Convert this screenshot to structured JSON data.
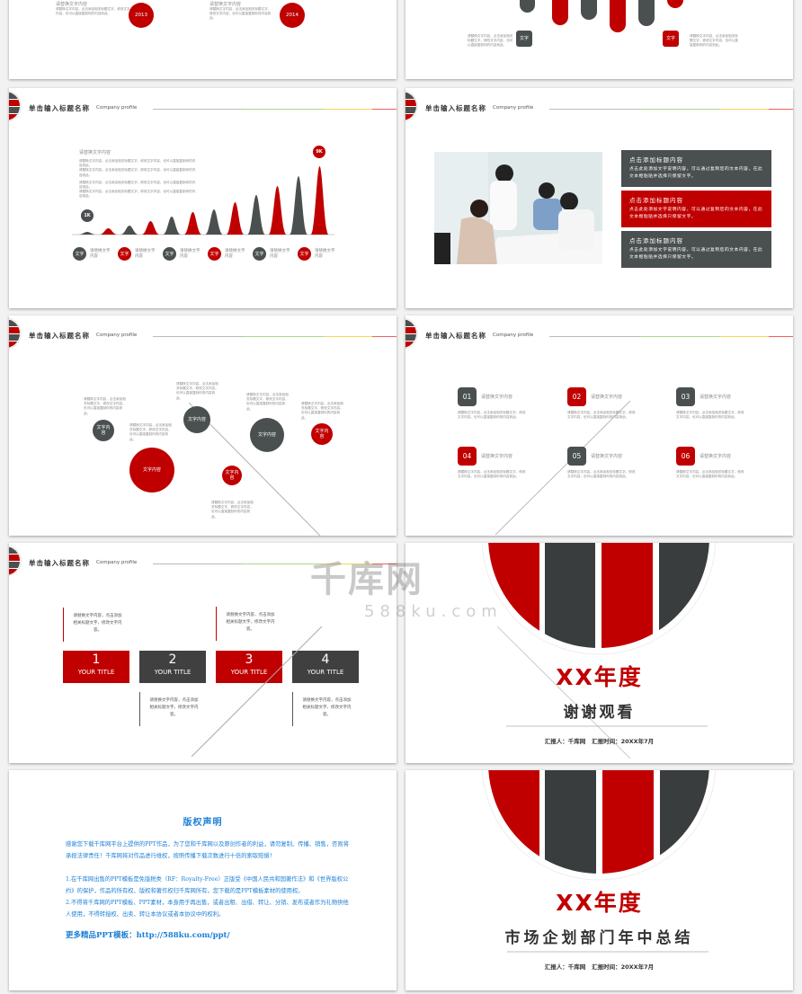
{
  "colors": {
    "red": "#c00000",
    "gray": "#4a4f50",
    "blue": "#1a7fd6"
  },
  "header": {
    "title": "单击输入标题名称",
    "subtitle": "Company profile"
  },
  "placeholder": {
    "heading": "请替换文字内容",
    "body": "请替换文字内容，点击添加相关标题文字，修改文字内容，也可以直接复制你的内容到此。",
    "short": "文字",
    "content": "文字内容"
  },
  "slide_timeline_top": {
    "items": [
      {
        "year": "2013"
      },
      {
        "year": "2014"
      }
    ]
  },
  "slide_bars_top": {
    "labels": [
      "文字",
      "文字"
    ]
  },
  "slide_peaks": {
    "start_label": "1K",
    "end_label": "9K",
    "peak_levels": [
      1,
      2,
      3,
      4,
      5,
      6,
      7,
      8,
      9,
      10,
      11,
      12
    ],
    "legend_label": "请替换文字内容"
  },
  "slide_photo": {
    "boxes": [
      {
        "title": "点击添加标题内容",
        "body": "点击此处添加文字说明内容，可以通过复制您的文本内容，在此文本框粘贴并选择只保留文字。"
      },
      {
        "title": "点击添加标题内容",
        "body": "点击此处添加文字说明内容，可以通过复制您的文本内容，在此文本框粘贴并选择只保留文字。"
      },
      {
        "title": "点击添加标题内容",
        "body": "点击此处添加文字说明内容，可以通过复制您的文本内容，在此文本框粘贴并选择只保留文字。"
      }
    ]
  },
  "slide_numbered": {
    "items": [
      {
        "num": "01",
        "label": "请替换文字内容"
      },
      {
        "num": "02",
        "label": "请替换文字内容"
      },
      {
        "num": "03",
        "label": "请替换文字内容"
      },
      {
        "num": "04",
        "label": "请替换文字内容"
      },
      {
        "num": "05",
        "label": "请替换文字内容"
      },
      {
        "num": "06",
        "label": "请替换文字内容"
      }
    ]
  },
  "slide_steps": {
    "items": [
      {
        "num": "1",
        "title": "YOUR TITLE"
      },
      {
        "num": "2",
        "title": "YOUR TITLE"
      },
      {
        "num": "3",
        "title": "YOUR TITLE"
      },
      {
        "num": "4",
        "title": "YOUR TITLE"
      }
    ],
    "text": "请替换文字内容，点击添加相关标题文字，修改文字内容。"
  },
  "slide_thanks": {
    "title": "XX年度",
    "subtitle": "谢谢观看",
    "reporter_label": "汇报人：",
    "reporter": "千库网",
    "time_label": "汇报时间：",
    "time": "20XX年7月"
  },
  "slide_copyright": {
    "title": "版权声明",
    "p1": "感谢您下载千库网平台上提供的PPT作品，为了您和千库网以及原创作者的利益，请勿复制、传播、销售，否则将承担法律责任！千库网将对作品进行维权，按照传播下载次数进行十倍的索取赔偿！",
    "p2": "1.在千库网出售的PPT模板是免版税类（RF：Royalty-Free）正版受《中国人民共和国著作法》和《世界版权公约》的保护，作品的所有权、版权和著作权归千库网所有，您下载的是PPT模板素材的使用权。",
    "p3": "2.不得将千库网的PPT模板、PPT素材，本身用于再出售，或者出租、出借、转让、分销、发布或者作为礼物供他人使用，不得转授权、出卖、转让本协议或者本协议中的权利。",
    "more": "更多精品PPT模板：http://588ku.com/ppt/"
  },
  "slide_cover": {
    "title": "XX年度",
    "subtitle": "市场企划部门年中总结",
    "reporter_label": "汇报人：",
    "reporter": "千库网",
    "time_label": "汇报时间：",
    "time": "20XX年7月"
  },
  "watermark": {
    "name": "千库网",
    "url": "588ku.com"
  }
}
